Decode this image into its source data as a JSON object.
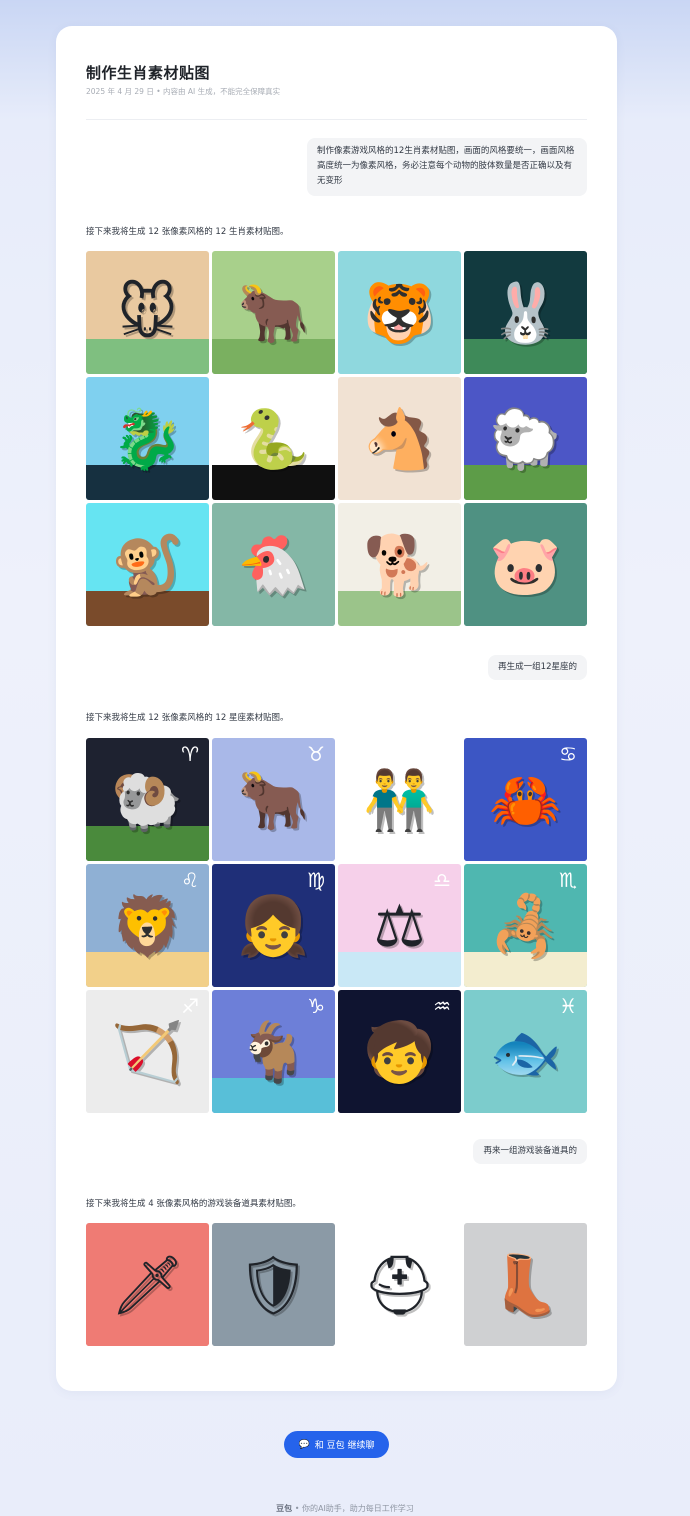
{
  "page": {
    "title": "制作生肖素材贴图",
    "meta": "2025 年 4 月 29 日 • 内容由 AI 生成，不能完全保障真实"
  },
  "messages": {
    "user1": "制作像素游戏风格的12生肖素材贴图，画面的风格要统一，画面风格高度统一为像素风格，务必注意每个动物的肢体数量是否正确以及有无变形",
    "assistant1": "接下来我将生成 12 张像素风格的 12 生肖素材贴图。",
    "user2": "再生成一组12星座的",
    "assistant2": "接下来我将生成 12 张像素风格的 12 星座素材贴图。",
    "user3": "再来一组游戏装备道具的",
    "assistant3": "接下来我将生成 4 张像素风格的游戏装备道具素材贴图。"
  },
  "zodiac": [
    {
      "icon": "rat-icon",
      "glyph": "🐭",
      "bg": "#e9c9a0",
      "bg2": "#7fbf80"
    },
    {
      "icon": "ox-icon",
      "glyph": "🐂",
      "bg": "#a8d08b",
      "bg2": "#7ab060"
    },
    {
      "icon": "tiger-icon",
      "glyph": "🐯",
      "bg": "#8fd8de",
      "bg2": "#8fd8de"
    },
    {
      "icon": "rabbit-icon",
      "glyph": "🐰",
      "bg": "#123a3f",
      "bg2": "#3e8a59"
    },
    {
      "icon": "dragon-icon",
      "glyph": "🐉",
      "bg": "#7fd0ef",
      "bg2": "#163040"
    },
    {
      "icon": "snake-icon",
      "glyph": "🐍",
      "bg": "#ffffff",
      "bg2": "#101010"
    },
    {
      "icon": "horse-icon",
      "glyph": "🐴",
      "bg": "#f1e2d3",
      "bg2": "#f1e2d3"
    },
    {
      "icon": "sheep-icon",
      "glyph": "🐑",
      "bg": "#4c56c6",
      "bg2": "#5d9c48"
    },
    {
      "icon": "monkey-icon",
      "glyph": "🐒",
      "bg": "#66e4f2",
      "bg2": "#7a4b2b"
    },
    {
      "icon": "rooster-icon",
      "glyph": "🐔",
      "bg": "#84b7a6",
      "bg2": "#84b7a6"
    },
    {
      "icon": "dog-icon",
      "glyph": "🐕",
      "bg": "#f2efe6",
      "bg2": "#9bc48a"
    },
    {
      "icon": "pig-icon",
      "glyph": "🐷",
      "bg": "#4f9182",
      "bg2": "#4f9182"
    }
  ],
  "constellations": [
    {
      "icon": "aries-icon",
      "glyph": "🐏",
      "sign": "♈",
      "bg": "#1e2230",
      "bg2": "#4a8a3c"
    },
    {
      "icon": "taurus-icon",
      "glyph": "🐂",
      "sign": "♉",
      "bg": "#a9b8e8",
      "bg2": "#a9b8e8"
    },
    {
      "icon": "gemini-icon",
      "glyph": "👬",
      "sign": "♊",
      "bg": "#ffffff",
      "bg2": "#ffffff"
    },
    {
      "icon": "cancer-icon",
      "glyph": "🦀",
      "sign": "♋",
      "bg": "#3c56c4",
      "bg2": "#3c56c4"
    },
    {
      "icon": "leo-icon",
      "glyph": "🦁",
      "sign": "♌",
      "bg": "#8fb0d4",
      "bg2": "#f2d08a"
    },
    {
      "icon": "virgo-icon",
      "glyph": "👧",
      "sign": "♍",
      "bg": "#1f2f78",
      "bg2": "#1f2f78"
    },
    {
      "icon": "libra-icon",
      "glyph": "⚖",
      "sign": "♎",
      "bg": "#f6d0ea",
      "bg2": "#c9e8f6"
    },
    {
      "icon": "scorpio-icon",
      "glyph": "🦂",
      "sign": "♏",
      "bg": "#4fb7b0",
      "bg2": "#f3edcf"
    },
    {
      "icon": "sagittarius-icon",
      "glyph": "🏹",
      "sign": "♐",
      "bg": "#ececec",
      "bg2": "#ececec"
    },
    {
      "icon": "capricorn-icon",
      "glyph": "🐐",
      "sign": "♑",
      "bg": "#6d7fd8",
      "bg2": "#58bfd8"
    },
    {
      "icon": "aquarius-icon",
      "glyph": "🧒",
      "sign": "♒",
      "bg": "#0f1430",
      "bg2": "#0f1430"
    },
    {
      "icon": "pisces-icon",
      "glyph": "🐟",
      "sign": "♓",
      "bg": "#7ccccc",
      "bg2": "#7ccccc"
    }
  ],
  "equipment": [
    {
      "icon": "sword-icon",
      "glyph": "🗡",
      "bg": "#ef7b74",
      "bg2": "#ef7b74"
    },
    {
      "icon": "shield-icon",
      "glyph": "🛡",
      "bg": "#8b9aa6",
      "bg2": "#8b9aa6"
    },
    {
      "icon": "helmet-icon",
      "glyph": "⛑",
      "bg": "#ffffff",
      "bg2": "#ffffff"
    },
    {
      "icon": "boots-icon",
      "glyph": "👢",
      "bg": "#cfd0d2",
      "bg2": "#cfd0d2"
    }
  ],
  "cta": {
    "icon": "chat-icon",
    "label": "和 豆包 继续聊"
  },
  "footer": {
    "brand": "豆包",
    "text": " • 你的AI助手，助力每日工作学习"
  }
}
